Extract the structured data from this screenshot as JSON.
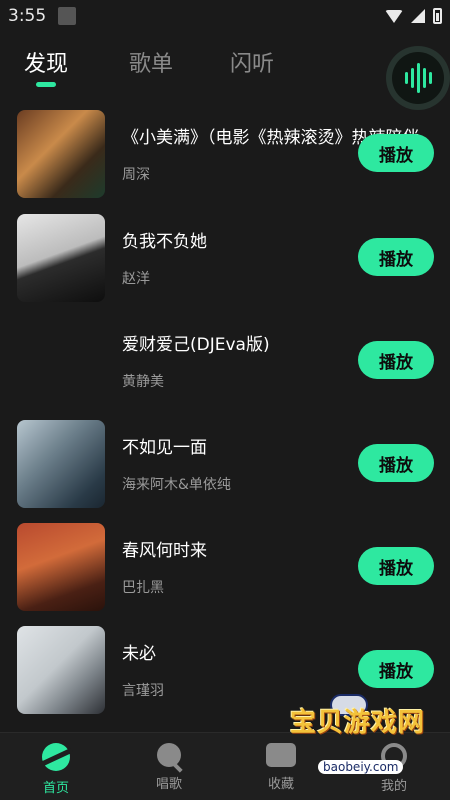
{
  "status_bar": {
    "time": "3:55"
  },
  "tabs": [
    {
      "label": "发现",
      "active": true
    },
    {
      "label": "歌单",
      "active": false
    },
    {
      "label": "闪听",
      "active": false
    }
  ],
  "songs": [
    {
      "title": "《小美满》（电影《热辣滚烫》热辣陪伴",
      "artist": "周深",
      "play_label": "播放"
    },
    {
      "title": "负我不负她",
      "artist": "赵洋",
      "play_label": "播放"
    },
    {
      "title": "爱财爱己(DJEva版)",
      "artist": "黄静美",
      "play_label": "播放"
    },
    {
      "title": "不如见一面",
      "artist": "海来阿木&单依纯",
      "play_label": "播放"
    },
    {
      "title": "春风何时来",
      "artist": "巴扎黑",
      "play_label": "播放"
    },
    {
      "title": "未必",
      "artist": "言瑾羽",
      "play_label": "播放"
    }
  ],
  "bottom_nav": [
    {
      "label": "首页",
      "icon": "home-icon",
      "active": true
    },
    {
      "label": "唱歌",
      "icon": "mic-icon",
      "active": false
    },
    {
      "label": "收藏",
      "icon": "favorites-icon",
      "active": false
    },
    {
      "label": "我的",
      "icon": "profile-icon",
      "active": false
    }
  ],
  "watermark": {
    "title": "宝贝游戏网",
    "url": "baobeiy.com"
  },
  "colors": {
    "accent": "#2ee8a0",
    "background": "#1a1a1a",
    "muted_text": "#9a9a9a"
  }
}
